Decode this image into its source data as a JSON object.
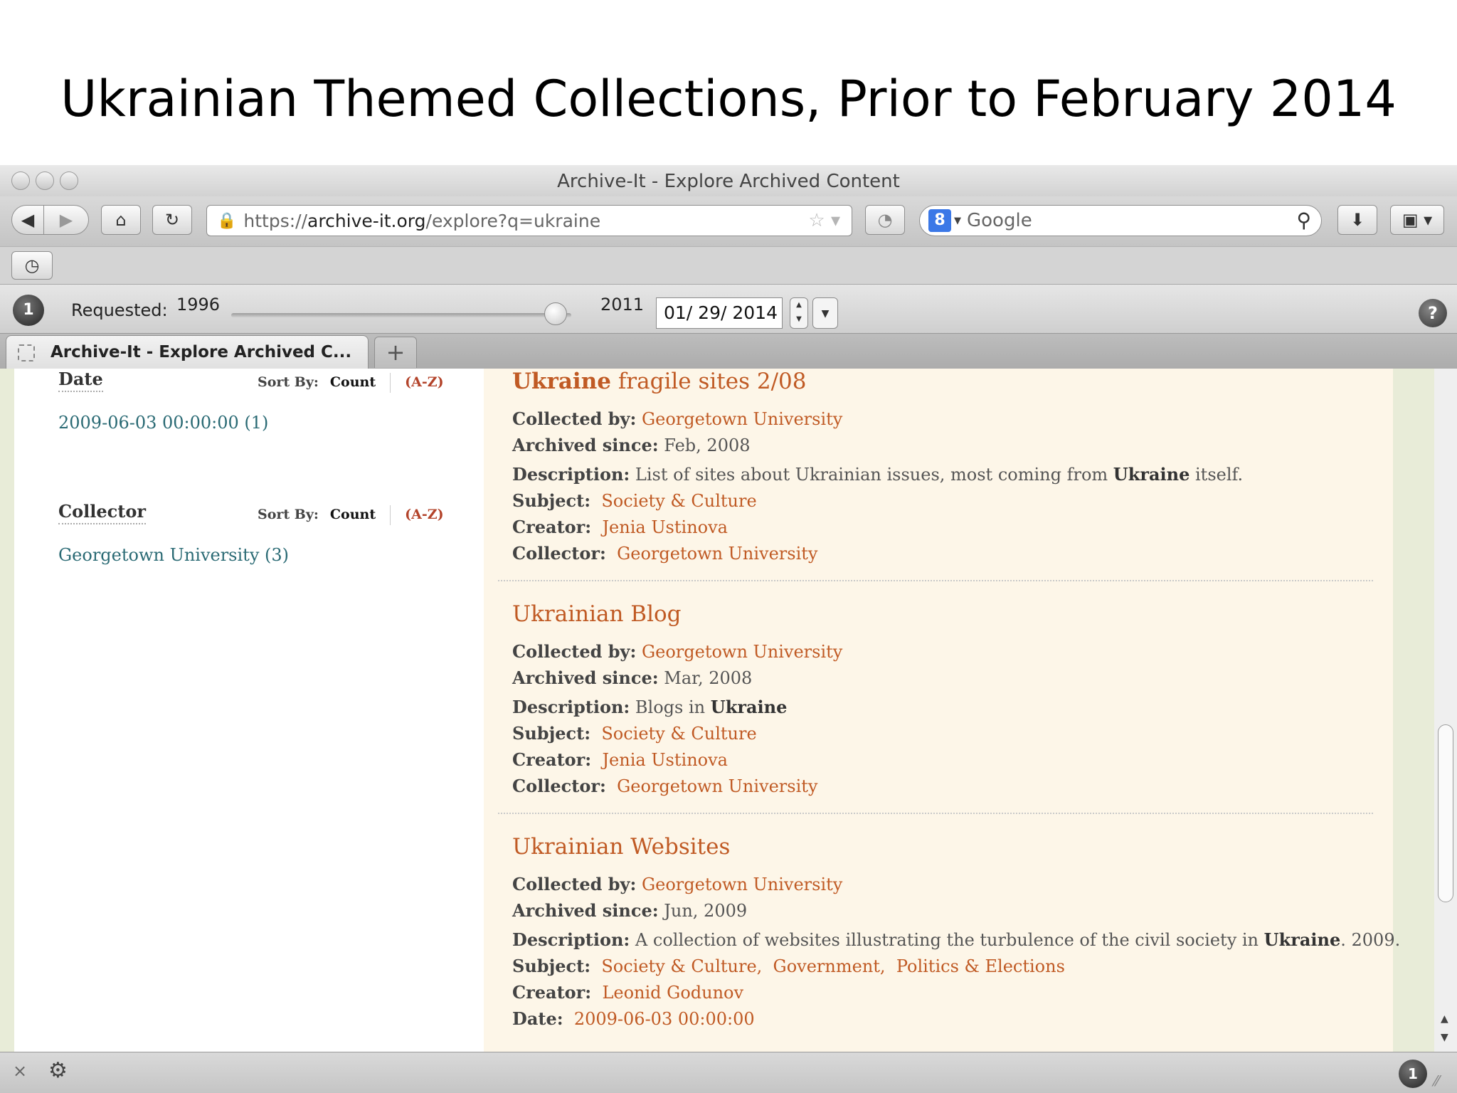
{
  "slide": {
    "title": "Ukrainian Themed Collections, Prior to February 2014"
  },
  "window": {
    "title": "Archive-It - Explore Archived Content"
  },
  "nav": {
    "url_scheme": "https://",
    "url_host": "archive-it.org",
    "url_path": "/explore?q=ukraine",
    "search_placeholder": "Google",
    "search_engine_badge": "8"
  },
  "wayback": {
    "requested_label": "Requested:",
    "year_start": "1996",
    "year_end": "2011",
    "date_value": "01/ 29/ 2014",
    "slider_position": 0.955,
    "badge": "1",
    "help": "?"
  },
  "tab": {
    "label": "Archive-It - Explore Archived C...",
    "new_tab": "+"
  },
  "sidebar": {
    "facets": [
      {
        "heading": "Date",
        "sort_by_label": "Sort By:",
        "sort_count": "Count",
        "sort_az": "(A-Z)",
        "items": [
          "2009-06-03 00:00:00 (1)"
        ]
      },
      {
        "heading": "Collector",
        "sort_by_label": "Sort By:",
        "sort_count": "Count",
        "sort_az": "(A-Z)",
        "items": [
          "Georgetown University (3)"
        ]
      }
    ]
  },
  "labels": {
    "collected_by": "Collected by:",
    "archived_since": "Archived since:",
    "description": "Description:",
    "subject": "Subject:",
    "creator": "Creator:",
    "collector": "Collector:",
    "date": "Date:"
  },
  "results": [
    {
      "title_bold": "Ukraine",
      "title_rest": " fragile sites 2/08",
      "collected_by": "Georgetown University",
      "archived_since": "Feb, 2008",
      "description_pre": "List of sites about Ukrainian issues, most coming from ",
      "description_kw": "Ukraine",
      "description_post": " itself.",
      "subject": "Society & Culture",
      "creator": "Jenia Ustinova",
      "collector": "Georgetown University"
    },
    {
      "title": "Ukrainian Blog",
      "collected_by": "Georgetown University",
      "archived_since": "Mar, 2008",
      "description_pre": "Blogs in ",
      "description_kw": "Ukraine",
      "subject": "Society & Culture",
      "creator": "Jenia Ustinova",
      "collector": "Georgetown University"
    },
    {
      "title": "Ukrainian Websites",
      "collected_by": "Georgetown University",
      "archived_since": "Jun, 2009",
      "description_pre": "A collection of websites illustrating the turbulence of the civil society in ",
      "description_kw": "Ukraine",
      "description_post": ". 2009.",
      "subjects": [
        "Society & Culture,",
        "Government,",
        "Politics & Elections"
      ],
      "creator": "Leonid Godunov",
      "date": "2009-06-03 00:00:00"
    }
  ],
  "status": {
    "close": "×",
    "badge": "1"
  },
  "colors": {
    "link_orange": "#c05a24",
    "facet_teal": "#2a6a74",
    "results_bg": "#fdf6e8"
  }
}
